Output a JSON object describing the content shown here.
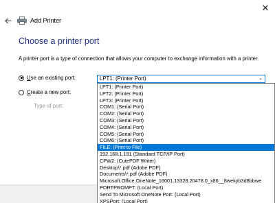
{
  "window": {
    "close_glyph": "✕",
    "title": "Add Printer"
  },
  "page": {
    "heading": "Choose a printer port",
    "description": "A printer port is a type of connection that allows your computer to exchange information with a printer."
  },
  "options": {
    "existing_prefix": "U",
    "existing_rest": "se an existing port:",
    "create_prefix": "C",
    "create_rest": "reate a new port:",
    "type_label": "Type of port:"
  },
  "select": {
    "value": "LPT1: (Printer Port)",
    "chevron": "⌄"
  },
  "dropdown": {
    "items": [
      "LPT1: (Printer Port)",
      "LPT2: (Printer Port)",
      "LPT3: (Printer Port)",
      "COM1: (Serial Port)",
      "COM2: (Serial Port)",
      "COM3: (Serial Port)",
      "COM4: (Serial Port)",
      "COM5: (Serial Port)",
      "COM6: (Serial Port)",
      "FILE: (Print to File)",
      "192.168.1.191 (Standard TCP/IP Port)",
      "CPW2: (CutePDF Writer)",
      "Desktop\\*.pdf (Adobe PDF)",
      "Documents\\*.pdf (Adobe PDF)",
      "Microsoft.Office.OneNote_16001.13328.20478.0_x86__8wekyb3d8bbwe",
      "PORTPROMPT: (Local Port)",
      "Send To Microsoft OneNote Port: (Local Port)",
      "XPSPort: (Local Port)"
    ],
    "selected_index": 9
  },
  "icons": {
    "back": "back-arrow-icon",
    "printer": "printer-icon"
  },
  "colors": {
    "heading": "#1e3287",
    "accent": "#0078d7"
  }
}
